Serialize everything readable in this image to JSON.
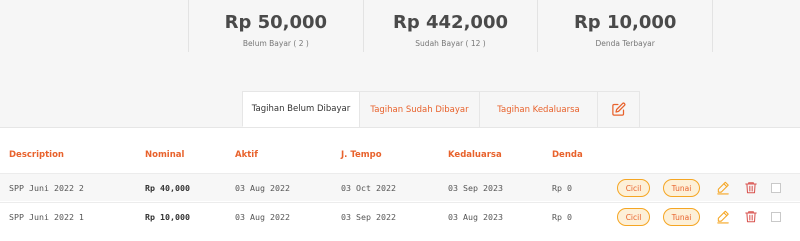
{
  "summary": [
    {
      "value": "Rp 50,000",
      "label": "Belum Bayar ( 2 )"
    },
    {
      "value": "Rp 442,000",
      "label": "Sudah Bayar ( 12 )"
    },
    {
      "value": "Rp 10,000",
      "label": "Denda Terbayar"
    }
  ],
  "tabs": [
    {
      "label": "Tagihan Belum Dibayar",
      "active": true
    },
    {
      "label": "Tagihan Sudah Dibayar",
      "active": false
    },
    {
      "label": "Tagihan Kedaluarsa",
      "active": false
    },
    {
      "icon": "edit-icon"
    }
  ],
  "table": {
    "headers": [
      "Description",
      "Nominal",
      "Aktif",
      "J. Tempo",
      "Kedaluarsa",
      "Denda"
    ],
    "rows": [
      {
        "description": "SPP Juni 2022 2",
        "nominal": "Rp 40,000",
        "aktif": "03 Aug 2022",
        "jatuh_tempo": "03 Oct 2022",
        "kedaluarsa": "03 Sep 2023",
        "denda": "Rp 0",
        "cicil": "Cicil",
        "tunai": "Tunai"
      },
      {
        "description": "SPP Juni 2022 1",
        "nominal": "Rp 10,000",
        "aktif": "03 Aug 2022",
        "jatuh_tempo": "03 Sep 2022",
        "kedaluarsa": "03 Aug 2023",
        "denda": "Rp 0",
        "cicil": "Cicil",
        "tunai": "Tunai"
      }
    ]
  },
  "colors": {
    "accent": "#e8622c",
    "pill_border": "#f5a623",
    "pill_bg": "#fdf0d8",
    "delete": "#d9534f"
  }
}
